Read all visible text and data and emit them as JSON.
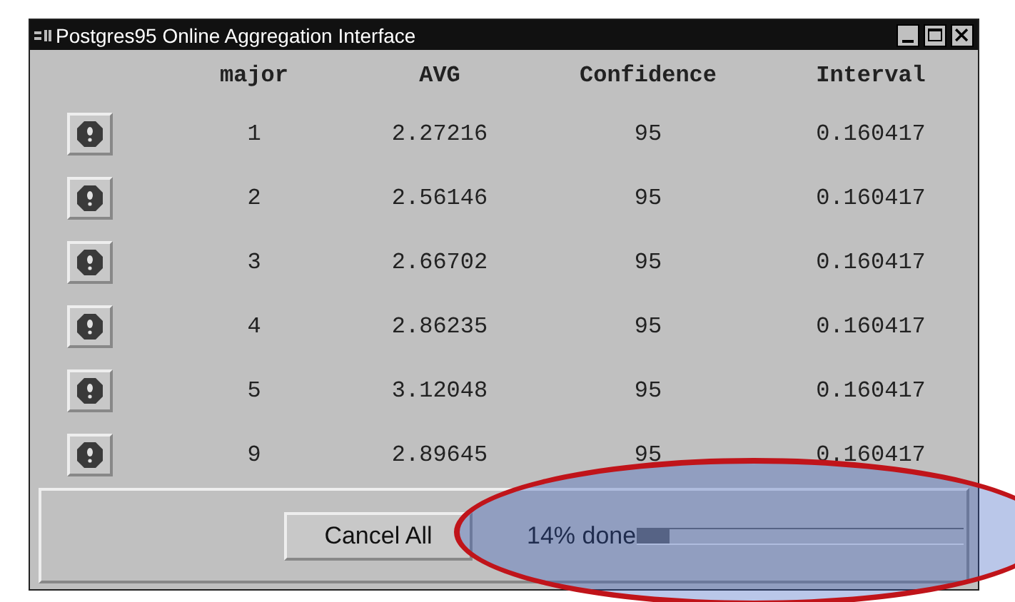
{
  "window": {
    "title": "Postgres95 Online Aggregation Interface"
  },
  "table": {
    "columns": [
      "major",
      "AVG",
      "Confidence",
      "Interval"
    ],
    "rows": [
      [
        "1",
        "2.27216",
        "95",
        "0.160417"
      ],
      [
        "2",
        "2.56146",
        "95",
        "0.160417"
      ],
      [
        "3",
        "2.66702",
        "95",
        "0.160417"
      ],
      [
        "4",
        "2.86235",
        "95",
        "0.160417"
      ],
      [
        "5",
        "3.12048",
        "95",
        "0.160417"
      ],
      [
        "9",
        "2.89645",
        "95",
        "0.160417"
      ]
    ]
  },
  "cancel_button": "Cancel All",
  "progress": {
    "label": "14% done",
    "level": 0.1
  }
}
